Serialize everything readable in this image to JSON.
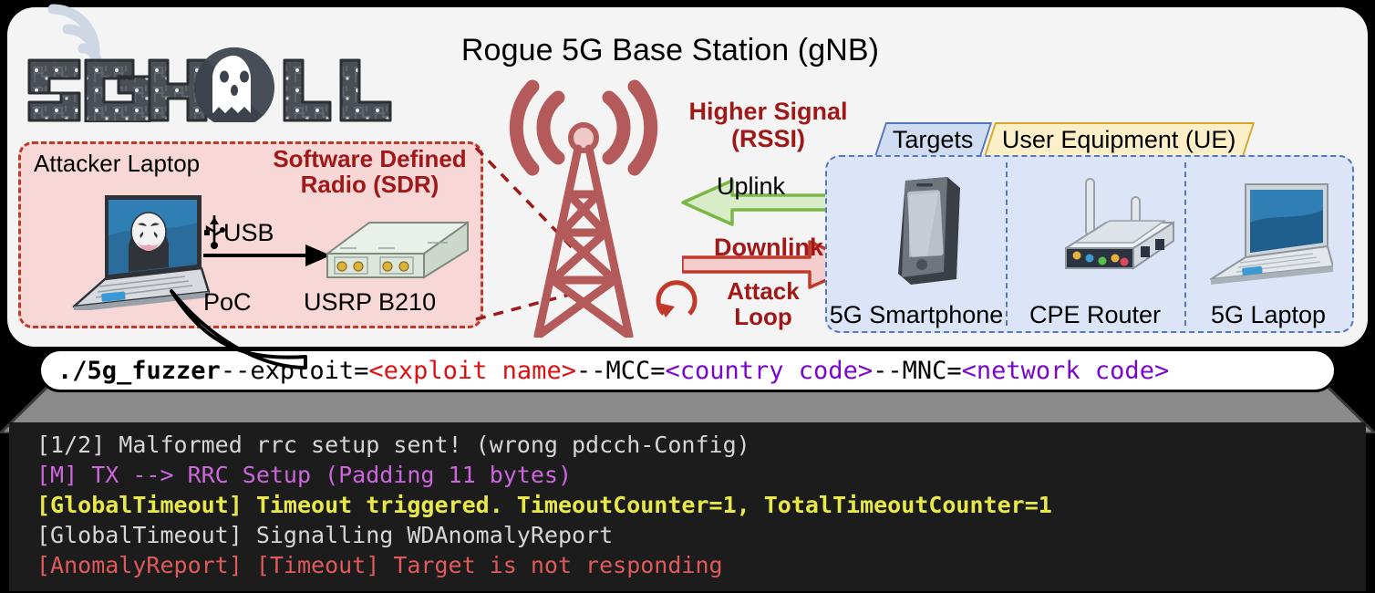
{
  "brand": {
    "name": "5GHOUL",
    "letters": [
      "5",
      "G",
      "H",
      "O",
      "U",
      "L"
    ]
  },
  "header": {
    "title": "Rogue 5G Base Station (gNB)"
  },
  "attacker": {
    "panel_label": "Attacker Laptop",
    "sdr_label": "Software Defined\nRadio (SDR)",
    "usb_label": "USB",
    "poc_label": "PoC",
    "device_label": "USRP B210",
    "panel_fill": "#f8d7d7",
    "panel_border": "#c0392b"
  },
  "signals": {
    "rssi_label": "Higher Signal\n(RSSI)",
    "uplink_label": "Uplink",
    "downlink_label": "Downlink",
    "attack_loop_label": "Attack\nLoop",
    "uplink_color": "#7ab648",
    "downlink_color": "#c0392b",
    "tower_color": "#b55a5a"
  },
  "ue": {
    "banner_targets": "Targets",
    "banner_title": "User Equipment (UE)",
    "panel_fill": "#dce5f7",
    "panel_border": "#5577bb",
    "items": [
      {
        "label": "5G Smartphone",
        "icon": "smartphone-icon"
      },
      {
        "label": "CPE Router",
        "icon": "router-icon"
      },
      {
        "label": "5G Laptop",
        "icon": "laptop-icon"
      }
    ]
  },
  "command": {
    "segments": [
      {
        "text": "./5g_fuzzer",
        "style": "bold"
      },
      {
        "text": " --exploit=",
        "style": "plain"
      },
      {
        "text": "<exploit name>",
        "style": "red"
      },
      {
        "text": " --MCC=",
        "style": "plain"
      },
      {
        "text": "<country code>",
        "style": "purple"
      },
      {
        "text": " --MNC=",
        "style": "plain"
      },
      {
        "text": "<network code>",
        "style": "purple"
      }
    ]
  },
  "terminal": {
    "lines": [
      {
        "text": "[1/2] Malformed rrc setup sent! (wrong pdcch-Config)",
        "style": "gray"
      },
      {
        "text": "[M] TX --> RRC Setup  (Padding 11 bytes)",
        "style": "magenta"
      },
      {
        "text": "[GlobalTimeout] Timeout triggered. TimeoutCounter=1, TotalTimeoutCounter=1",
        "style": "yellow"
      },
      {
        "text": "[GlobalTimeout] Signalling WDAnomalyReport",
        "style": "gray"
      },
      {
        "text": "[AnomalyReport] [Timeout] Target is not responding",
        "style": "red"
      }
    ],
    "colors": {
      "gray": "#d6d6d6",
      "magenta": "#cc66dd",
      "yellow": "#e8e84a",
      "red": "#e05a5a",
      "background": "#1c1c1c"
    }
  }
}
